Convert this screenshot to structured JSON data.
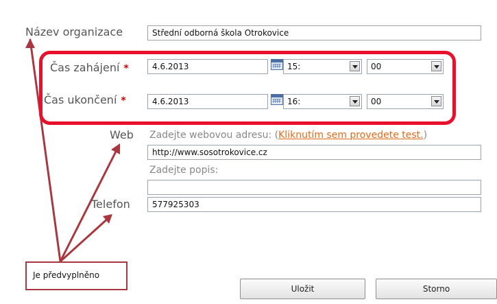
{
  "form": {
    "organization": {
      "label": "Název organizace",
      "value": "Střední odborná škola Otrokovice"
    },
    "start_time": {
      "label": "Čas zahájení",
      "required_mark": "*",
      "date": "4.6.2013",
      "hour": "15:",
      "minute": "00"
    },
    "end_time": {
      "label": "Čas ukončení",
      "required_mark": "*",
      "date": "4.6.2013",
      "hour": "16:",
      "minute": "00"
    },
    "web": {
      "label": "Web",
      "url_hint": "Zadejte webovou adresu: (",
      "test_link": "Kliknutím sem provedete test.",
      "url_hint_close": ")",
      "url_value": "http://www.sosotrokovice.cz",
      "desc_hint": "Zadejte popis:",
      "desc_value": ""
    },
    "phone": {
      "label": "Telefon",
      "value": "577925303"
    }
  },
  "buttons": {
    "save": "Uložit",
    "cancel": "Storno"
  },
  "annotation": {
    "callout": "Je předvyplněno",
    "highlight_color": "#e8102a",
    "arrow_color": "#a9373f"
  }
}
